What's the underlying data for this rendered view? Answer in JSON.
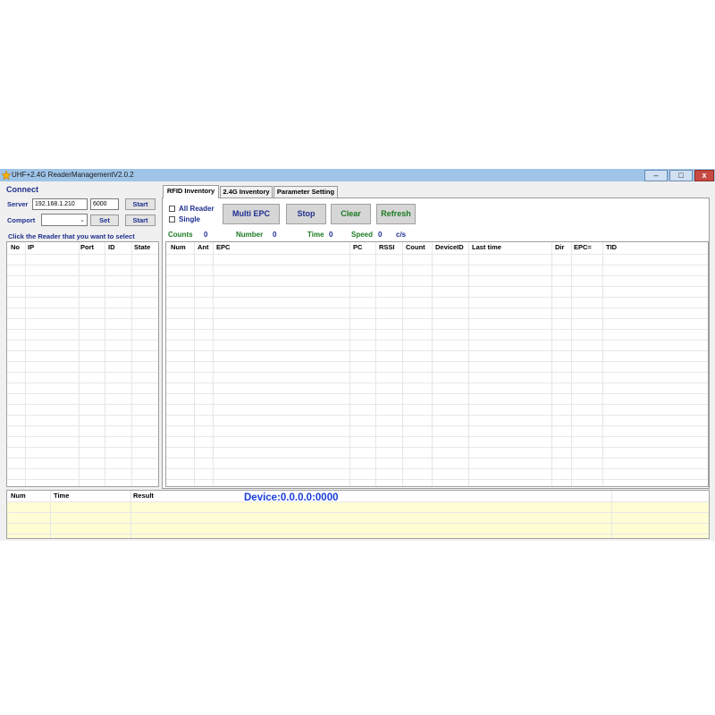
{
  "window": {
    "title": "UHF+2.4G ReaderManagementV2.0.2",
    "controls": {
      "minimize": "–",
      "maximize": "□",
      "close": "x"
    }
  },
  "connect": {
    "heading": "Connect",
    "server_label": "Server",
    "server_ip": "192.168.1.210",
    "server_port": "6000",
    "server_start": "Start",
    "comport_label": "Comport",
    "comport_value": "",
    "comport_set": "Set",
    "comport_start": "Start",
    "select_hint": "Click the Reader that you want to select"
  },
  "reader_list": {
    "columns": [
      "No",
      "IP",
      "Port",
      "ID",
      "State"
    ],
    "rows": []
  },
  "tabs": [
    "RFID Inventory",
    "2.4G Inventory",
    "Parameter Setting"
  ],
  "active_tab": "RFID Inventory",
  "inventory": {
    "all_reader": "All Reader",
    "single": "Single",
    "buttons": {
      "multi_epc": "Multi EPC",
      "stop": "Stop",
      "clear": "Clear",
      "refresh": "Refresh"
    },
    "stats": {
      "counts_label": "Counts",
      "counts_value": "0",
      "number_label": "Number",
      "number_value": "0",
      "time_label": "Time",
      "time_value": "0",
      "speed_label": "Speed",
      "speed_value": "0",
      "speed_unit": "c/s"
    },
    "columns": [
      "Num",
      "Ant",
      "EPC",
      "PC",
      "RSSI",
      "Count",
      "DeviceID",
      "Last time",
      "Dir",
      "EPC=",
      "TID"
    ],
    "rows": []
  },
  "log": {
    "columns": [
      "Num",
      "Time",
      "Result"
    ],
    "device": "Device:0.0.0.0:0000"
  },
  "colors": {
    "titlebar": "#9fc4e8",
    "window_bg": "#f0f0f0",
    "navy_text": "#1f2f8f",
    "green_text": "#1b7a22",
    "log_bg": "#fffdd4",
    "device_text": "#1a3fd6"
  }
}
